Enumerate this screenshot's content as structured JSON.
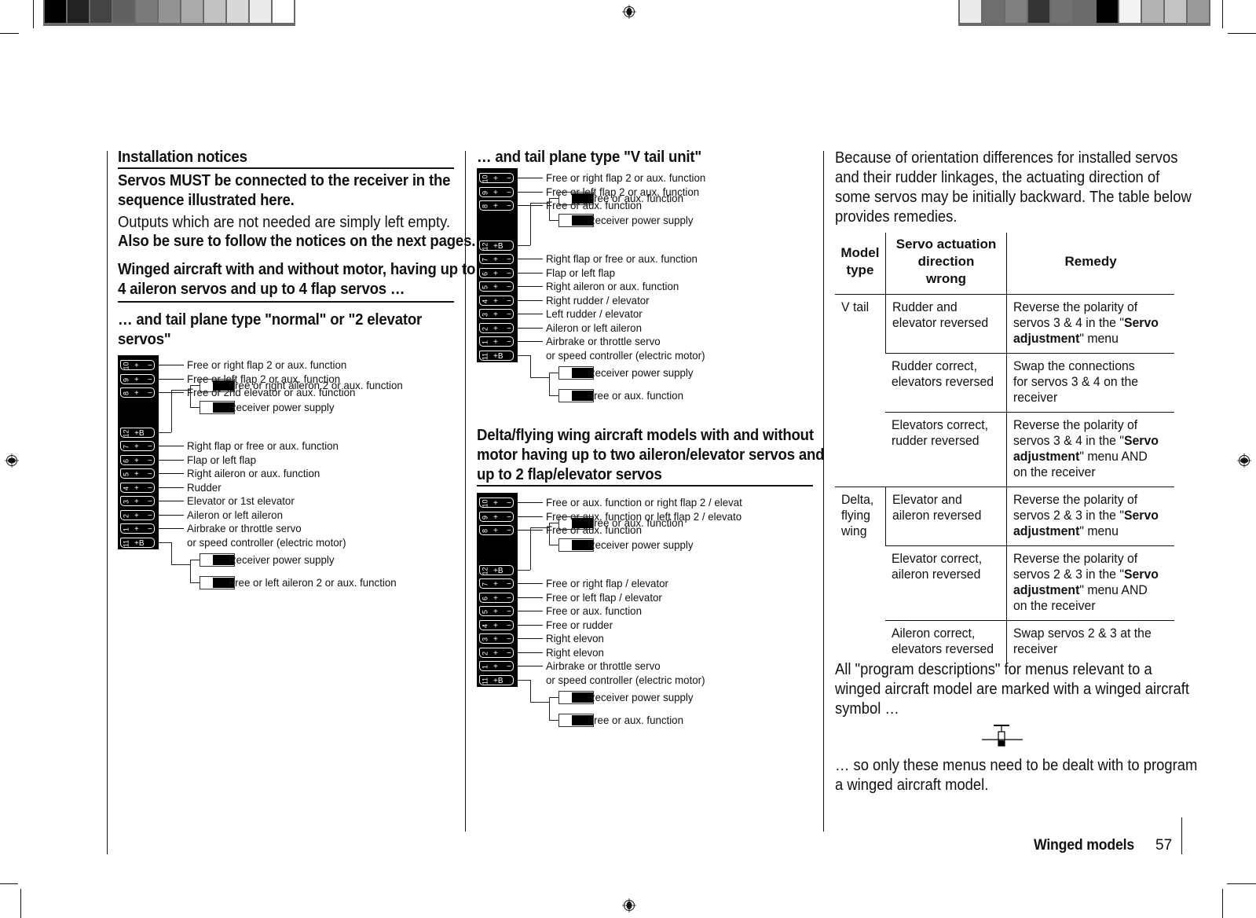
{
  "print_marks": {
    "left_swatches": [
      "#000000",
      "#222222",
      "#444444",
      "#616161",
      "#7a7a7a",
      "#939393",
      "#aaaaaa",
      "#c2c2c2",
      "#d8d8d8",
      "#ebebeb",
      "#ffffff"
    ],
    "right_swatches": [
      "#ebebeb",
      "#6e6e6e",
      "#808080",
      "#333333",
      "#727272",
      "#6a6a6a",
      "#000000",
      "#f3f3f3",
      "#b4b4b4",
      "#c3c3c3",
      "#9a9a9a"
    ]
  },
  "col1": {
    "title": "Installation notices",
    "bold_notice": [
      "Servos MUST be connected to the receiver in the",
      "sequence illustrated here."
    ],
    "note": "Outputs which are not needed are simply left empty.",
    "bold_note": "Also be sure to follow the notices on the next pages.",
    "section_heading": [
      "Winged aircraft with and without motor, having up to",
      "4 aileron servos and up to 4 flap servos …"
    ],
    "sub_heading": [
      "… and tail plane type \"normal\" or \"2 elevator",
      "servos\""
    ],
    "diagram": {
      "ports": [
        {
          "num": "10",
          "sign": "+",
          "minus": "−",
          "label": "Free or right flap 2 or aux. function"
        },
        {
          "num": "9",
          "sign": "+",
          "minus": "−",
          "label": "Free or left flap 2 or aux. function"
        },
        {
          "num": "8",
          "sign": "+",
          "minus": "−",
          "label": "Free or 2nd elevator or aux. function"
        },
        {
          "num": "12",
          "sign": "+B",
          "minus": "",
          "label": ""
        },
        {
          "num": "7",
          "sign": "+",
          "minus": "−",
          "label": "Right flap or free or aux. function"
        },
        {
          "num": "6",
          "sign": "+",
          "minus": "−",
          "label": "Flap or left flap"
        },
        {
          "num": "5",
          "sign": "+",
          "minus": "−",
          "label": "Right aileron or aux. function"
        },
        {
          "num": "4",
          "sign": "+",
          "minus": "−",
          "label": "Rudder"
        },
        {
          "num": "3",
          "sign": "+",
          "minus": "−",
          "label": "Elevator or 1st elevator"
        },
        {
          "num": "2",
          "sign": "+",
          "minus": "−",
          "label": "Aileron or left aileron"
        },
        {
          "num": "1",
          "sign": "+",
          "minus": "−",
          "label": "Airbrake or throttle servo"
        },
        {
          "num": "11",
          "sign": "+B",
          "minus": "",
          "label": "or speed controller (electric motor)"
        }
      ],
      "upper_plugs": [
        "Free or right aileron 2 or aux. function",
        "Receiver power supply"
      ],
      "lower_plugs": [
        "Receiver power supply",
        "Free or left aileron 2 or aux. function"
      ]
    }
  },
  "col2": {
    "sub_heading": "… and tail plane type \"V tail unit\"",
    "diagram1": {
      "ports": [
        {
          "num": "10",
          "sign": "+",
          "minus": "−",
          "label": "Free or right flap 2 or aux. function"
        },
        {
          "num": "9",
          "sign": "+",
          "minus": "−",
          "label": "Free or left flap 2 or aux. function"
        },
        {
          "num": "8",
          "sign": "+",
          "minus": "−",
          "label": "Free or aux. function"
        },
        {
          "num": "12",
          "sign": "+B",
          "minus": "",
          "label": ""
        },
        {
          "num": "7",
          "sign": "+",
          "minus": "−",
          "label": "Right flap or free or aux. function"
        },
        {
          "num": "6",
          "sign": "+",
          "minus": "−",
          "label": "Flap or left flap"
        },
        {
          "num": "5",
          "sign": "+",
          "minus": "−",
          "label": "Right aileron or aux. function"
        },
        {
          "num": "4",
          "sign": "+",
          "minus": "−",
          "label": "Right rudder / elevator"
        },
        {
          "num": "3",
          "sign": "+",
          "minus": "−",
          "label": "Left rudder / elevator"
        },
        {
          "num": "2",
          "sign": "+",
          "minus": "−",
          "label": "Aileron or left aileron"
        },
        {
          "num": "1",
          "sign": "+",
          "minus": "−",
          "label": "Airbrake or throttle servo"
        },
        {
          "num": "11",
          "sign": "+B",
          "minus": "",
          "label": "or speed controller (electric motor)"
        }
      ],
      "upper_plugs": [
        "Free or aux. function",
        "Receiver power supply"
      ],
      "lower_plugs": [
        "Receiver power supply",
        "Free or aux. function"
      ]
    },
    "section_heading": [
      "Delta/flying wing aircraft models with and without",
      "motor having up to two aileron/elevator servos and",
      "up to 2 flap/elevator servos"
    ],
    "diagram2": {
      "ports": [
        {
          "num": "10",
          "sign": "+",
          "minus": "−",
          "label": "Free or aux. function or right flap 2 / elevat"
        },
        {
          "num": "9",
          "sign": "+",
          "minus": "−",
          "label": "Free or aux. function or left flap 2 / elevato"
        },
        {
          "num": "8",
          "sign": "+",
          "minus": "−",
          "label": "Free or aux. function"
        },
        {
          "num": "12",
          "sign": "+B",
          "minus": "",
          "label": ""
        },
        {
          "num": "7",
          "sign": "+",
          "minus": "−",
          "label": "Free or right flap / elevator"
        },
        {
          "num": "6",
          "sign": "+",
          "minus": "−",
          "label": "Free or left flap / elevator"
        },
        {
          "num": "5",
          "sign": "+",
          "minus": "−",
          "label": "Free or aux. function"
        },
        {
          "num": "4",
          "sign": "+",
          "minus": "−",
          "label": "Free or rudder"
        },
        {
          "num": "3",
          "sign": "+",
          "minus": "−",
          "label": "Right elevon"
        },
        {
          "num": "2",
          "sign": "+",
          "minus": "−",
          "label": "Right elevon"
        },
        {
          "num": "1",
          "sign": "+",
          "minus": "−",
          "label": "Airbrake or throttle servo"
        },
        {
          "num": "11",
          "sign": "+B",
          "minus": "",
          "label": "or speed controller (electric motor)"
        }
      ],
      "upper_plugs": [
        "Free or aux. function",
        "Receiver power supply"
      ],
      "lower_plugs": [
        "Receiver power supply",
        "Free or aux. function"
      ]
    }
  },
  "col3": {
    "intro": [
      "Because of orientation differences for installed servos",
      "and their rudder linkages, the actuating direction of",
      "some servos may be initially backward. The table below",
      "provides remedies."
    ],
    "table": {
      "headers": {
        "model": [
          "Model",
          "type"
        ],
        "direction": [
          "Servo actuation",
          "direction",
          "wrong"
        ],
        "remedy": "Remedy"
      },
      "groups": [
        {
          "model": [
            "V tail"
          ],
          "rows": [
            {
              "direction": [
                "Rudder and",
                "elevator reversed"
              ],
              "remedy": {
                "pre": [
                  "Reverse the polarity of",
                  "servos 3 & 4 in the \""
                ],
                "bold1": "Servo",
                "bold2": "adjustment",
                "post": "\" menu",
                "tail": ""
              }
            },
            {
              "direction": [
                "Rudder correct,",
                "elevators reversed"
              ],
              "remedy_plain": [
                "Swap the connections",
                "for servos 3 & 4 on the",
                "receiver"
              ]
            },
            {
              "direction": [
                "Elevators correct,",
                "rudder reversed"
              ],
              "remedy": {
                "pre": [
                  "Reverse the polarity of",
                  "servos 3 & 4 in the \""
                ],
                "bold1": "Servo",
                "bold2": "adjustment",
                "post": "\" menu AND",
                "tail": "on the receiver"
              }
            }
          ]
        },
        {
          "model": [
            "Delta,",
            "flying",
            "wing"
          ],
          "rows": [
            {
              "direction": [
                "Elevator and",
                "aileron reversed"
              ],
              "remedy": {
                "pre": [
                  "Reverse the polarity of",
                  "servos 2 & 3 in the \""
                ],
                "bold1": "Servo",
                "bold2": "adjustment",
                "post": "\" menu",
                "tail": ""
              }
            },
            {
              "direction": [
                "Elevator correct,",
                "aileron reversed"
              ],
              "remedy": {
                "pre": [
                  "Reverse the polarity of",
                  "servos 2 & 3 in the \""
                ],
                "bold1": "Servo",
                "bold2": "adjustment",
                "post": "\" menu AND",
                "tail": "on the receiver"
              }
            },
            {
              "direction": [
                "Aileron correct,",
                "elevators reversed"
              ],
              "remedy_plain": [
                "Swap servos 2 & 3 at the",
                "receiver"
              ]
            }
          ]
        }
      ]
    },
    "outro1": [
      "All \"program descriptions\" for menus relevant to a",
      "winged aircraft model are marked with a winged aircraft",
      "symbol …"
    ],
    "outro2": [
      "… so only these menus need to be dealt with to program",
      "a winged aircraft model."
    ]
  },
  "footer": {
    "section": "Winged models",
    "page_number": "57"
  }
}
